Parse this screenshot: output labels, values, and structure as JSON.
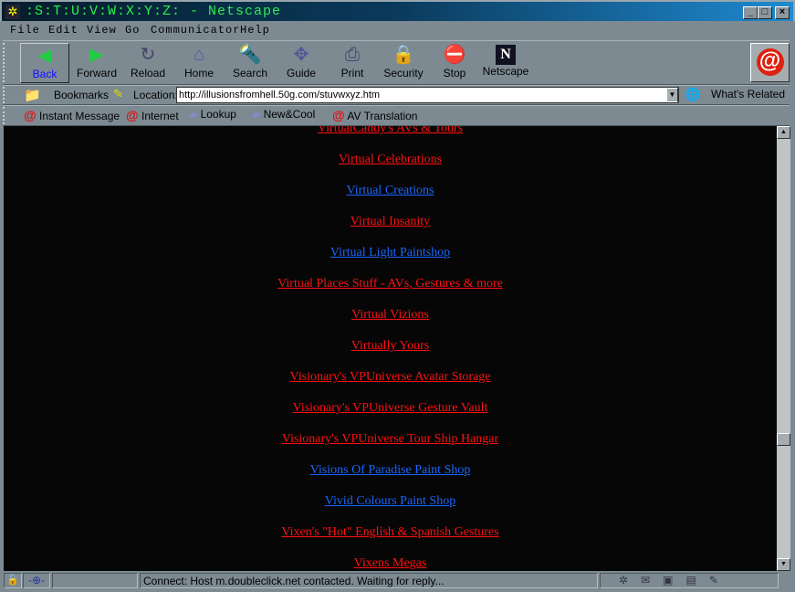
{
  "window": {
    "title": ":S:T:U:V:W:X:Y:Z: - Netscape"
  },
  "menu": [
    "File",
    "Edit",
    "View",
    "Go",
    "Communicator",
    "Help"
  ],
  "toolbar": [
    {
      "label": "Back",
      "icon": "back-arrow-icon"
    },
    {
      "label": "Forward",
      "icon": "forward-arrow-icon"
    },
    {
      "label": "Reload",
      "icon": "reload-icon"
    },
    {
      "label": "Home",
      "icon": "home-icon"
    },
    {
      "label": "Search",
      "icon": "search-icon"
    },
    {
      "label": "Guide",
      "icon": "guide-icon"
    },
    {
      "label": "Print",
      "icon": "print-icon"
    },
    {
      "label": "Security",
      "icon": "lock-icon"
    },
    {
      "label": "Stop",
      "icon": "stop-icon"
    },
    {
      "label": "Netscape",
      "icon": "netscape-logo-icon"
    }
  ],
  "location": {
    "bookmarks_label": "Bookmarks",
    "location_label": "Location:",
    "url": "http://illusionsfromhell.50g.com/stuvwxyz.htm",
    "whats_related": "What's Related"
  },
  "personal": [
    "Instant Message",
    "Internet",
    "Lookup",
    "New&Cool",
    "AV Translation"
  ],
  "colors": {
    "red_link": "#ff1010",
    "blue_link": "#1a66ff",
    "background": "#060606"
  },
  "links": [
    {
      "text": "VirtualCandy's AVs & Tours",
      "color": "red"
    },
    {
      "text": "Virtual Celebrations",
      "color": "red"
    },
    {
      "text": "Virtual Creations",
      "color": "blue"
    },
    {
      "text": "Virtual Insanity",
      "color": "red"
    },
    {
      "text": "Virtual Light Paintshop",
      "color": "blue"
    },
    {
      "text": "Virtual Places Stuff - AVs, Gestures & more",
      "color": "red"
    },
    {
      "text": "Virtual Vizions",
      "color": "red"
    },
    {
      "text": "Virtually Yours",
      "color": "red"
    },
    {
      "text": "Visionary's VPUniverse Avatar Storage",
      "color": "red"
    },
    {
      "text": "Visionary's VPUniverse Gesture Vault",
      "color": "red"
    },
    {
      "text": "Visionary's VPUniverse Tour Ship Hangar",
      "color": "red"
    },
    {
      "text": "Visions Of Paradise Paint Shop",
      "color": "blue"
    },
    {
      "text": "Vivid Colours Paint Shop",
      "color": "blue"
    },
    {
      "text": "Vixen's \"Hot\" English & Spanish Gestures",
      "color": "red"
    },
    {
      "text": "Vixens Megas",
      "color": "red"
    }
  ],
  "status": {
    "text": "Connect: Host m.doubleclick.net contacted. Waiting for reply..."
  }
}
